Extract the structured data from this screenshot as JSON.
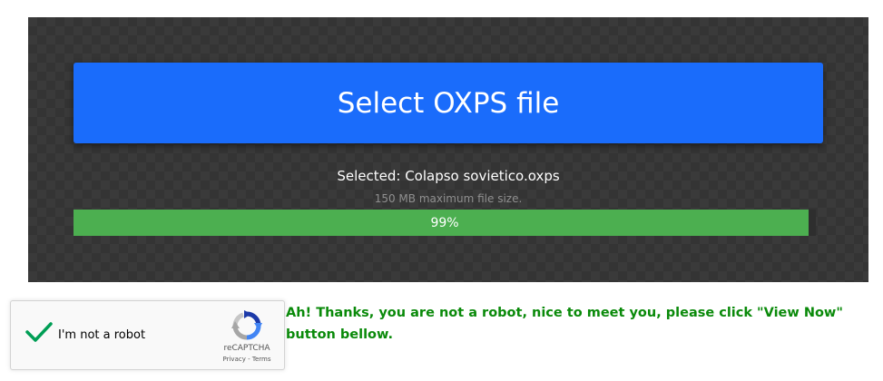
{
  "upload": {
    "select_button_label": "Select OXPS file",
    "selected_text": "Selected: Colapso sovietico.oxps",
    "max_size_note": "150 MB maximum file size.",
    "progress_percent": 99,
    "progress_label": "99%",
    "colors": {
      "button": "#1a6cfb",
      "progress": "#4caf50",
      "panel": "#3a3a3a"
    }
  },
  "recaptcha": {
    "checkbox_label": "I'm not a robot",
    "checked": true,
    "brand": "reCAPTCHA",
    "privacy_link": "Privacy",
    "separator": " - ",
    "terms_link": "Terms",
    "check_icon": "checkmark-icon",
    "logo_icon": "recaptcha-logo-icon",
    "colors": {
      "check": "#009e55"
    }
  },
  "message": {
    "text": "Ah! Thanks, you are not a robot, nice to meet you, please click \"View Now\" button bellow.",
    "color": "#0a8a0a"
  }
}
